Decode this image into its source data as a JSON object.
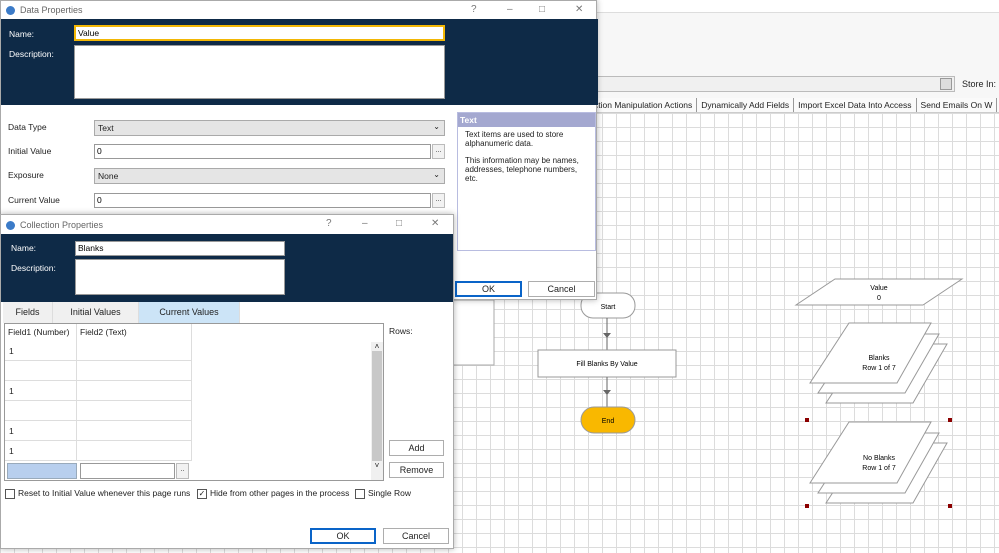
{
  "app": {
    "store_in_label": "Store In:",
    "process_tabs": [
      "ction Manipulation Actions",
      "Dynamically Add Fields",
      "Import Excel Data Into Access",
      "Send Emails On W"
    ]
  },
  "data_properties": {
    "title": "Data Properties",
    "name_label": "Name:",
    "name_value": "Value",
    "description_label": "Description:",
    "description_value": "",
    "data_type_label": "Data Type",
    "data_type_value": "Text",
    "initial_value_label": "Initial Value",
    "initial_value": "0",
    "exposure_label": "Exposure",
    "exposure_value": "None",
    "current_value_label": "Current Value",
    "current_value": "0",
    "help_title": "Text",
    "help_p1": "Text items are used to store alphanumeric data.",
    "help_p2": "This information may be names, addresses, telephone numbers, etc.",
    "ok": "OK",
    "cancel": "Cancel",
    "dots": "..."
  },
  "collection_properties": {
    "title": "Collection Properties",
    "name_label": "Name:",
    "name_value": "Blanks",
    "description_label": "Description:",
    "tabs": [
      "Fields",
      "Initial Values",
      "Current Values"
    ],
    "active_tab": "Current Values",
    "columns": [
      "Field1  (Number)",
      "Field2  (Text)"
    ],
    "rows": [
      [
        "1",
        ""
      ],
      [
        "",
        ""
      ],
      [
        "1",
        ""
      ],
      [
        "",
        ""
      ],
      [
        "1",
        ""
      ],
      [
        "1",
        ""
      ]
    ],
    "rows_label": "Rows:",
    "add": "Add",
    "remove": "Remove",
    "reset_label": "Reset to Initial Value whenever this page runs",
    "reset_checked": false,
    "hide_label": "Hide from other pages in the process",
    "hide_checked": true,
    "single_row_label": "Single Row",
    "single_row_checked": false,
    "ok": "OK",
    "cancel": "Cancel",
    "dots": ".."
  },
  "flow": {
    "start": "Start",
    "action": "Fill Blanks By Value",
    "end": "End",
    "data_item_name": "Value",
    "data_item_value": "0",
    "coll1_name": "Blanks",
    "coll1_row": "Row 1 of 7",
    "coll2_name": "No Blanks",
    "coll2_row": "Row 1 of 7",
    "end_color": "#f9b800"
  }
}
